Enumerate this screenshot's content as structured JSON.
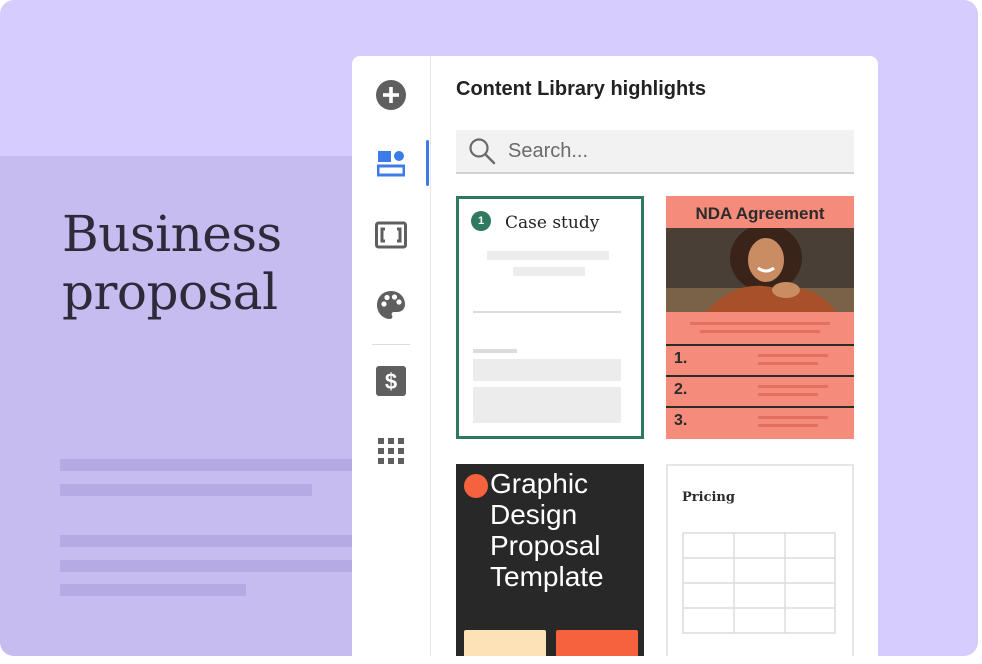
{
  "document": {
    "title_line1": "Business",
    "title_line2": "proposal"
  },
  "sidebar": {
    "items": [
      {
        "name": "add",
        "icon": "plus-circle-icon"
      },
      {
        "name": "content-library",
        "icon": "blocks-icon",
        "active": true
      },
      {
        "name": "embed",
        "icon": "bracket-frame-icon"
      },
      {
        "name": "theme",
        "icon": "palette-icon"
      },
      {
        "name": "pricing",
        "icon": "dollar-icon"
      },
      {
        "name": "more",
        "icon": "grid-icon"
      }
    ]
  },
  "panel": {
    "title": "Content Library highlights",
    "search": {
      "placeholder": "Search...",
      "value": ""
    },
    "cards": [
      {
        "type": "case-study",
        "badge": "1",
        "title": "Case study",
        "selected": true
      },
      {
        "type": "nda",
        "title": "NDA Agreement",
        "items": [
          "1.",
          "2.",
          "3."
        ]
      },
      {
        "type": "graphic-design",
        "title": "Graphic Design Proposal Template"
      },
      {
        "type": "pricing",
        "title": "Pricing"
      }
    ]
  },
  "colors": {
    "background": "#d6ccfd",
    "accent": "#3d7ce8",
    "selected_border": "#2f7a5f",
    "nda": "#f58b7a",
    "gdp_dark": "#282828",
    "gdp_orange": "#f5623d"
  }
}
